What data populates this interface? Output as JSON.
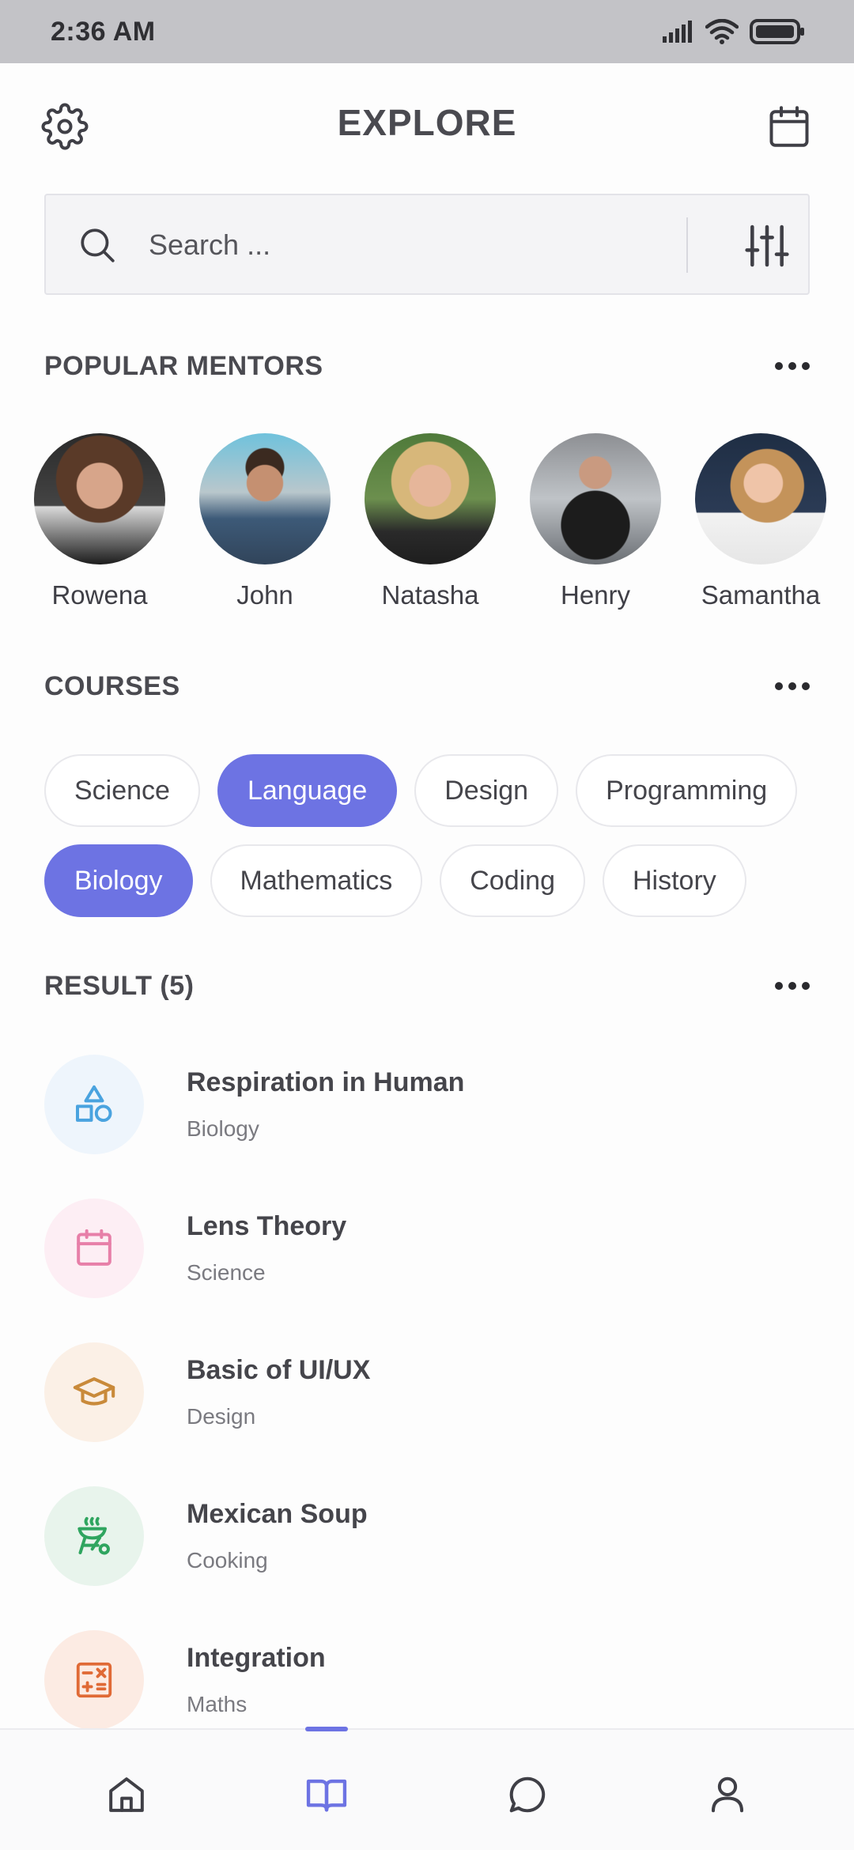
{
  "status_bar": {
    "time": "2:36 AM",
    "icons": [
      "signal-icon",
      "wifi-icon",
      "battery-icon"
    ]
  },
  "header": {
    "title": "EXPLORE",
    "left_icon": "gear-icon",
    "right_icon": "calendar-icon"
  },
  "search": {
    "placeholder": "Search ...",
    "value": "",
    "icon": "search-icon",
    "filter_icon": "sliders-icon"
  },
  "mentors_section": {
    "title": "POPULAR MENTORS",
    "mentors": [
      {
        "name": "Rowena"
      },
      {
        "name": "John"
      },
      {
        "name": "Natasha"
      },
      {
        "name": "Henry"
      },
      {
        "name": "Samantha"
      }
    ]
  },
  "courses_section": {
    "title": "COURSES",
    "chips_row1": [
      {
        "label": "Science",
        "active": false
      },
      {
        "label": "Language",
        "active": true
      },
      {
        "label": "Design",
        "active": false
      },
      {
        "label": "Programming",
        "active": false
      }
    ],
    "chips_row2": [
      {
        "label": "Biology",
        "active": true
      },
      {
        "label": "Mathematics",
        "active": false
      },
      {
        "label": "Coding",
        "active": false
      },
      {
        "label": "History",
        "active": false
      }
    ]
  },
  "results_section": {
    "title": "RESULT (5)",
    "items": [
      {
        "title": "Respiration in Human",
        "category": "Biology",
        "icon": "shapes-icon",
        "color": "#4aa3df",
        "bg": "#eef5fc"
      },
      {
        "title": "Lens Theory",
        "category": "Science",
        "icon": "calendar-icon",
        "color": "#e77fa8",
        "bg": "#fdeef4"
      },
      {
        "title": "Basic of UI/UX",
        "category": "Design",
        "icon": "graduation-cap-icon",
        "color": "#c98a3a",
        "bg": "#fbf0e6"
      },
      {
        "title": "Mexican Soup",
        "category": "Cooking",
        "icon": "grill-icon",
        "color": "#2fa55f",
        "bg": "#e8f4ec"
      },
      {
        "title": "Integration",
        "category": "Maths",
        "icon": "calculator-icon",
        "color": "#e06a36",
        "bg": "#fcebe3"
      }
    ]
  },
  "bottom_nav": {
    "items": [
      "home-icon",
      "book-icon",
      "chat-icon",
      "user-icon"
    ],
    "active": "book-icon"
  },
  "colors": {
    "accent": "#6d73e3",
    "status_bar": "#c3c3c7",
    "text": "#45454b"
  }
}
